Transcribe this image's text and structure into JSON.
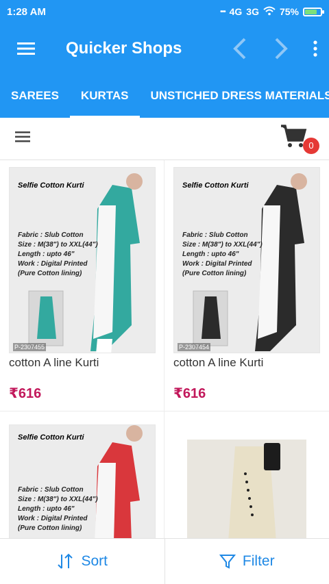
{
  "status_bar": {
    "time": "1:28 AM",
    "network_1": "4G",
    "network_2": "3G",
    "battery": "75%",
    "battery_level": 0.75
  },
  "app_bar": {
    "title": "Quicker Shops",
    "menu_icon": "hamburger-menu-icon",
    "back_icon": "chevron-left-icon",
    "forward_icon": "chevron-right-icon",
    "more_icon": "more-vert-icon"
  },
  "tabs": [
    {
      "label": "SAREES"
    },
    {
      "label": "KURTAS"
    },
    {
      "label": "UNSTICHED DRESS MATERIALS"
    }
  ],
  "active_tab": "KURTAS",
  "toolbar": {
    "cart_count": "0"
  },
  "products": [
    {
      "name": "cotton A line Kurti",
      "price": "₹616",
      "image_color": "#33a99f",
      "photo_title": "Selfie Cotton Kurti",
      "details": [
        "Fabric : Slub Cotton",
        "Size : M(38\") to XXL(44\")",
        "Length : upto 46\"",
        "Work : Digital Printed",
        "(Pure Cotton lining)"
      ],
      "pid": "P-2307455"
    },
    {
      "name": "cotton A line Kurti",
      "price": "₹616",
      "image_color": "#2b2b2b",
      "photo_title": "Selfie Cotton Kurti",
      "details": [
        "Fabric : Slub Cotton",
        "Size : M(38\") to XXL(44\")",
        "Length : upto 46\"",
        "Work : Digital Printed",
        "(Pure Cotton lining)"
      ],
      "pid": "P-2307454"
    },
    {
      "name": "",
      "price": "",
      "image_color": "#d9373c",
      "photo_title": "Selfie Cotton Kurti",
      "details": [
        "Fabric : Slub Cotton",
        "Size : M(38\") to XXL(44\")",
        "Length : upto 46\"",
        "Work : Digital Printed",
        "(Pure Cotton lining)"
      ],
      "pid": ""
    },
    {
      "name": "",
      "price": "",
      "image_color": "#e8e0c7",
      "photo_title": "",
      "details": [],
      "pid": ""
    }
  ],
  "bottom_bar": {
    "sort_label": "Sort",
    "filter_label": "Filter",
    "sort_icon": "sort-arrows-icon",
    "filter_icon": "funnel-icon"
  },
  "colors": {
    "primary": "#2196f3",
    "price": "#c2185b",
    "badge": "#e53935",
    "action": "#1e88e5"
  }
}
